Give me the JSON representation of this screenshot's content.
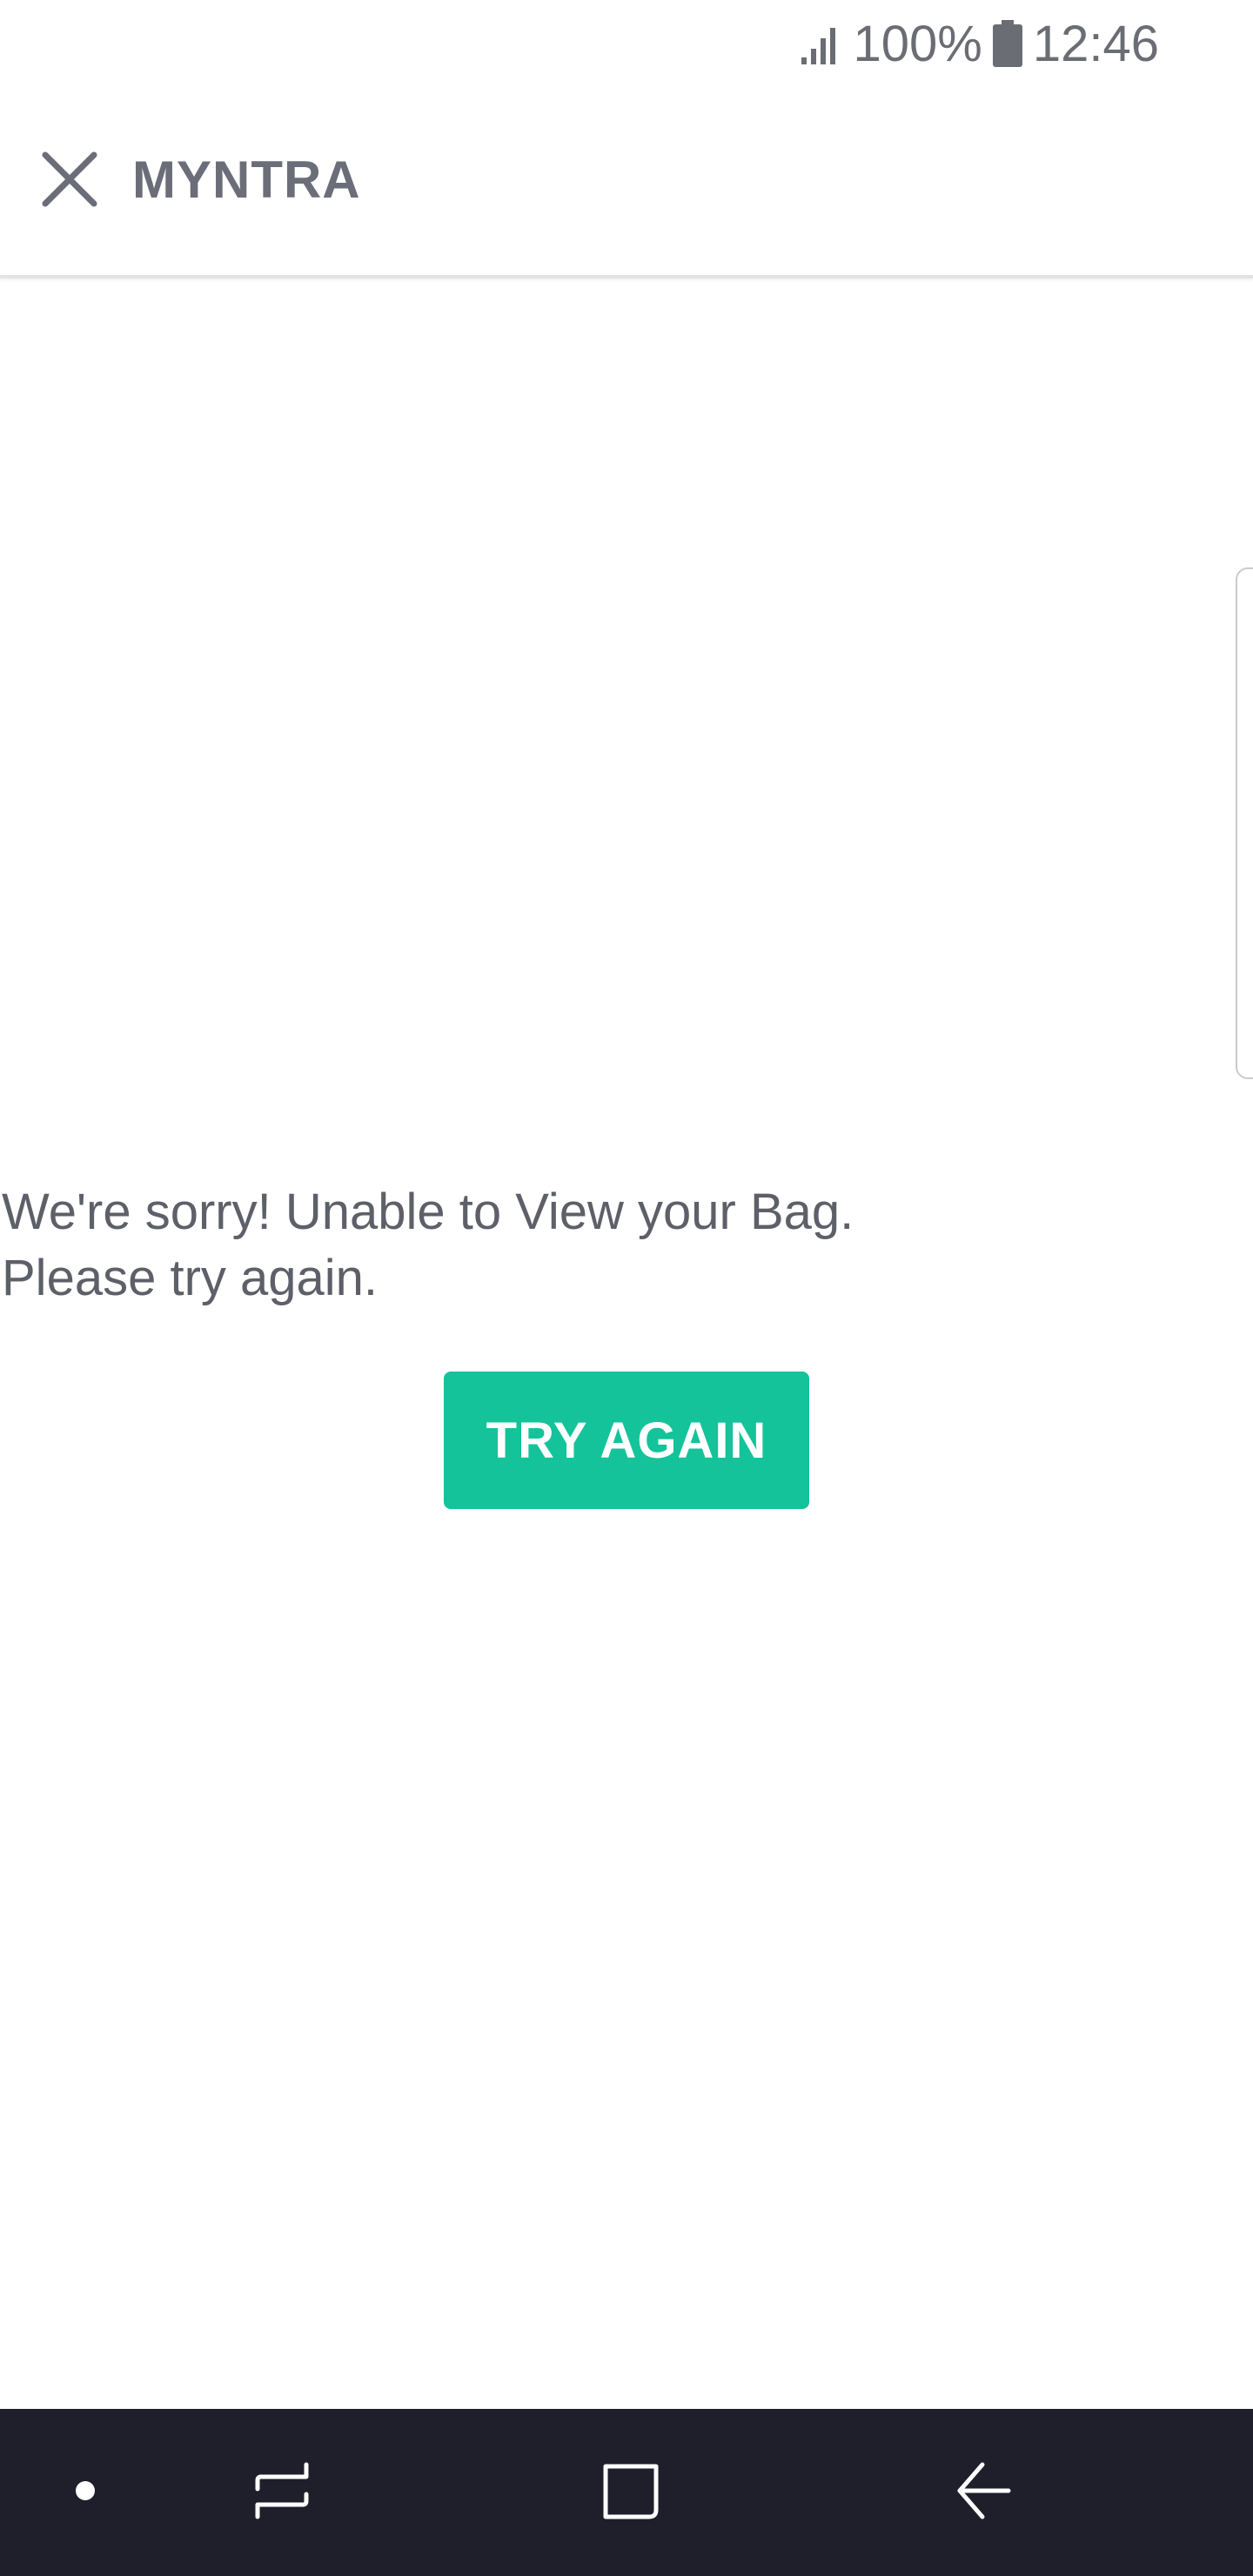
{
  "status_bar": {
    "battery_percent": "100%",
    "time": "12:46",
    "icons": [
      "signal-icon",
      "battery-icon"
    ]
  },
  "header": {
    "close_icon": "close-icon",
    "title": "MYNTRA"
  },
  "error": {
    "line1": "We're sorry! Unable to View your Bag.",
    "line2": "Please try again.",
    "button_label": "TRY AGAIN"
  },
  "nav_bar": {
    "items": [
      "dot-icon",
      "recents-icon",
      "home-icon",
      "back-icon"
    ]
  },
  "colors": {
    "accent": "#14c39a",
    "nav_background": "#1e1f2b",
    "text": "#5d6068"
  }
}
